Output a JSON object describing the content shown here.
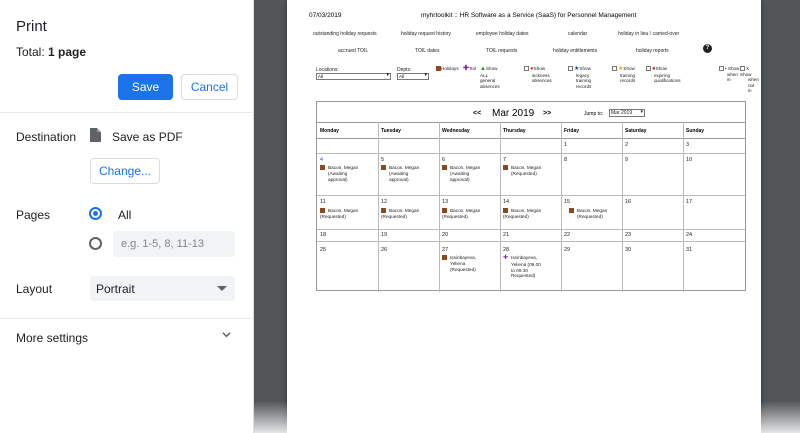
{
  "panel": {
    "title": "Print",
    "total_label": "Total:",
    "total_value": "1 page",
    "save_label": "Save",
    "cancel_label": "Cancel",
    "destination_label": "Destination",
    "destination_value": "Save as PDF",
    "change_label": "Change...",
    "pages_label": "Pages",
    "pages_all": "All",
    "pages_placeholder": "e.g. 1-5, 8, 11-13",
    "layout_label": "Layout",
    "layout_value": "Portrait",
    "more_settings": "More settings"
  },
  "colors": {
    "accent": "#1a73e8",
    "preview_bg": "#525659",
    "holiday": "#8b4a1c",
    "toil": "#8e24aa"
  },
  "sheet": {
    "date": "07/03/2019",
    "title": "myhrtoolkit :: HR Software as a Service (SaaS) for Personnel Management",
    "nav_row1": [
      "outstanding holiday requests",
      "holiday request history",
      "employee holiday dates",
      "calendar",
      "holiday in lieu / carried-over"
    ],
    "nav_row2": [
      "accrued TOIL",
      "TOIL dates",
      "TOIL requests",
      "holiday entitlements",
      "holiday reports"
    ],
    "help_icon": "question-circle-icon",
    "locations_label": "Locations:",
    "locations_value": "All",
    "depts_label": "Depts:",
    "depts_value": "All",
    "legend_holidays": "Holidays",
    "legend_toil": "Toil",
    "legend_general_1": "Show",
    "legend_general_2": "ALL",
    "legend_general_3": "general",
    "legend_general_4": "absences",
    "legend_sick_1": "Show",
    "legend_sick_2": "sickness",
    "legend_sick_3": "absences",
    "legend_legacy_1": "Show",
    "legend_legacy_2": "legacy",
    "legend_legacy_3": "training",
    "legend_legacy_4": "records",
    "legend_training_1": "Show",
    "legend_training_2": "training",
    "legend_training_3": "records",
    "legend_expiring_1": "Show",
    "legend_expiring_2": "expiring",
    "legend_expiring_3": "qualifications",
    "legend_in_1": "• Show",
    "legend_in_2": "when",
    "legend_in_3": "in",
    "legend_notin_1": "X Show",
    "legend_notin_2": "when",
    "legend_notin_3": "not",
    "legend_notin_4": "in"
  },
  "calendar": {
    "prev": "<<",
    "month": "Mar 2019",
    "next": ">>",
    "jump_label": "Jump to:",
    "jump_value": "Mar 2019",
    "weekdays": [
      "Monday",
      "Tuesday",
      "Wednesday",
      "Thursday",
      "Friday",
      "Saturday",
      "Sunday"
    ],
    "weeks": [
      [
        "",
        "",
        "",
        "",
        "1",
        "2",
        "3"
      ],
      [
        "4",
        "5",
        "6",
        "7",
        "8",
        "9",
        "10"
      ],
      [
        "11",
        "12",
        "13",
        "14",
        "15",
        "16",
        "17"
      ],
      [
        "18",
        "19",
        "20",
        "21",
        "22",
        "23",
        "24"
      ],
      [
        "25",
        "26",
        "27",
        "28",
        "29",
        "30",
        "31"
      ]
    ],
    "events": {
      "w2d1": [
        "Bacon, Megan",
        "(Awaiting",
        "approval)"
      ],
      "w2d2": [
        "Bacon, Megan",
        "(Awaiting",
        "approval)"
      ],
      "w2d3": [
        "Bacon, Megan",
        "(Awaiting",
        "approval)"
      ],
      "w2d4": [
        "Bacon, Megan",
        "(Requested)"
      ],
      "w3d1": [
        "Bacon, Megan",
        "(Requested)"
      ],
      "w3d2": [
        "Bacon, Megan",
        "(Requested)"
      ],
      "w3d3": [
        "Bacon, Megan",
        "(Requested)"
      ],
      "w3d4": [
        "Bacon, Megan",
        "(Requested)"
      ],
      "w3d5": [
        "Bacon, Megan",
        "(Requested)"
      ],
      "w5d3": [
        "Issinbayeva,",
        "Yeliena",
        "(Requested)"
      ],
      "w5d4": [
        "Issinbayeva,",
        "Yeliena (09.00",
        "to 09.30",
        "Requested)"
      ]
    }
  }
}
